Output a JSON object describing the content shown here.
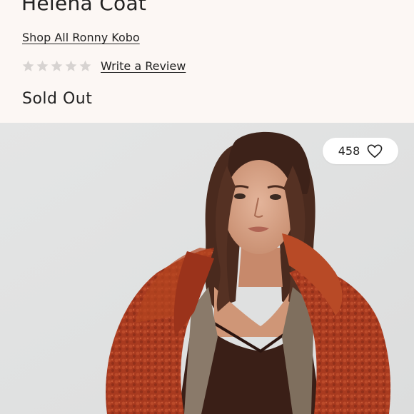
{
  "product": {
    "title": "Helena Coat",
    "shop_all_label": "Shop All Ronny Kobo",
    "rating_stars": 0,
    "write_review_label": "Write a Review",
    "status": "Sold Out"
  },
  "favorites": {
    "count": "458",
    "icon": "heart-icon"
  },
  "colors": {
    "page_bg": "#fcf7f4",
    "star_empty": "#d7d3d1",
    "coat": "#a93a1f"
  }
}
